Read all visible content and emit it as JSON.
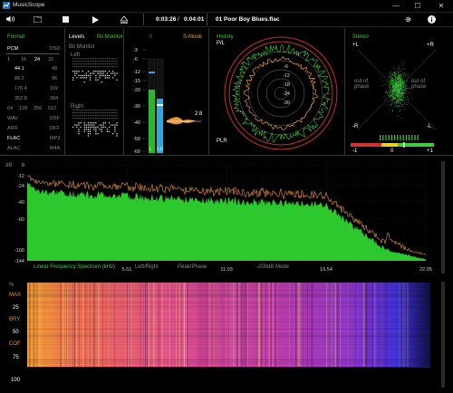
{
  "app": {
    "title": "MusicScope"
  },
  "window": {
    "minimize": "—",
    "maximize": "☐",
    "close": "✕"
  },
  "toolbar": {
    "time_current": "0:03:26",
    "time_sep": "/",
    "time_total": "0:04:01",
    "track": "01 Poor Boy Blues.flac"
  },
  "format": {
    "title": "Format",
    "pcm": "PCM",
    "dsd": "DSD",
    "bits": [
      "1",
      "16",
      "24",
      "32"
    ],
    "rates_left": [
      "44.1",
      "88.2",
      "176.4",
      "352.8"
    ],
    "rates_right": [
      "48",
      "96",
      "192",
      "384"
    ],
    "dsd_rates": [
      "64",
      "128",
      "256",
      "512"
    ],
    "containers": [
      [
        "WAV",
        "DSF"
      ],
      [
        "AIFF",
        "DFF"
      ],
      [
        "FLAC",
        "MP3"
      ],
      [
        "ALAC",
        "M4A"
      ]
    ]
  },
  "levels": {
    "title": "Levels",
    "bitmonitor": "Bit Monitor",
    "bitmonitor2": "Bit Monitor",
    "left": "Left",
    "right": "Right",
    "scale": [
      "0",
      "-3",
      "-6",
      "-12",
      "-15",
      "-20",
      "-30",
      "-40",
      "-50",
      "-60"
    ],
    "bar_left_label": "L",
    "bar_right_label": "LU",
    "s_mode": "S-Mode",
    "peak_value": "2.8"
  },
  "history": {
    "title": "History",
    "pl_label": "P/L",
    "plr_label": "PLR",
    "rings": [
      "-6",
      "-12",
      "-18",
      "-24",
      "-30"
    ]
  },
  "stereo": {
    "title": "Stereo",
    "plus_l": "+L",
    "plus_r": "+R",
    "minus_l": "-R",
    "minus_r": "-L",
    "out_left": "out of\nphase",
    "out_right": "out of\nphase",
    "bal_left": "-1",
    "bal_center": "0",
    "bal_right": "+1"
  },
  "spectrum": {
    "db_label": "dB",
    "y_ticks": [
      "0",
      "-12",
      "-24",
      "-40",
      "-60",
      "-100",
      "-144"
    ],
    "x_ticks": [
      "5.51",
      "11.03",
      "16.54",
      "22.05"
    ],
    "mode_label": "Linear Frequency Spectrum (kHz)",
    "opt1": "Left/Right",
    "opt2": "Peak/Phase",
    "opt3": "-200dB Mode"
  },
  "spectrogram": {
    "pct_label": "%",
    "ticks": [
      "MAX",
      "25",
      "BRY",
      "50",
      "COF",
      "75",
      "100"
    ]
  },
  "colors": {
    "green": "#3ccc3c",
    "orange": "#e8963a",
    "red": "#d23232",
    "blue": "#3aa0d8"
  }
}
